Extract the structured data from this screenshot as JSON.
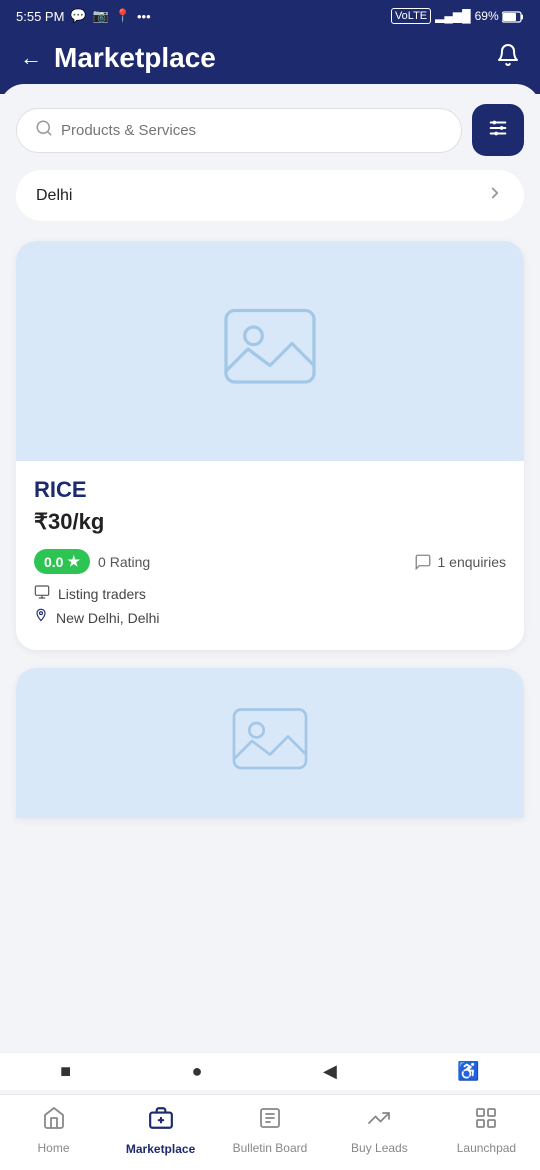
{
  "statusBar": {
    "time": "5:55 PM",
    "icons": [
      "whatsapp",
      "instagram",
      "location",
      "more"
    ],
    "rightIcons": [
      "volte",
      "4g",
      "signal",
      "battery"
    ],
    "battery": "69"
  },
  "header": {
    "title": "Marketplace",
    "backLabel": "←",
    "bellLabel": "🔔"
  },
  "search": {
    "placeholder": "Products & Services",
    "filterIconLabel": "⚙"
  },
  "location": {
    "city": "Delhi",
    "chevron": "›"
  },
  "product1": {
    "name": "RICE",
    "price": "₹30/kg",
    "rating": "0.0",
    "ratingStar": "★",
    "ratingCount": "0 Rating",
    "enquiries": "1 enquiries",
    "trader": "Listing traders",
    "location": "New Delhi, Delhi"
  },
  "bottomNav": {
    "items": [
      {
        "id": "home",
        "label": "Home",
        "active": false
      },
      {
        "id": "marketplace",
        "label": "Marketplace",
        "active": true
      },
      {
        "id": "bulletin",
        "label": "Bulletin Board",
        "active": false
      },
      {
        "id": "buyleads",
        "label": "Buy Leads",
        "active": false
      },
      {
        "id": "launchpad",
        "label": "Launchpad",
        "active": false
      }
    ]
  },
  "systemNav": {
    "square": "■",
    "circle": "●",
    "back": "◀",
    "accessibility": "♿"
  }
}
